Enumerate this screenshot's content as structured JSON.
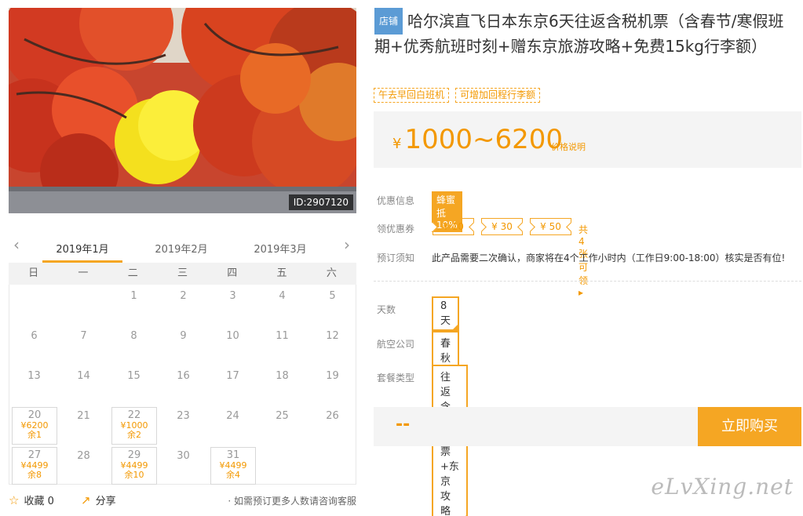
{
  "photo": {
    "id_label": "ID:2907120"
  },
  "calendar": {
    "prev_icon": "chevron-left",
    "next_icon": "chevron-right",
    "months": [
      "2019年1月",
      "2019年2月",
      "2019年3月"
    ],
    "weekdays": [
      "日",
      "一",
      "二",
      "三",
      "四",
      "五",
      "六"
    ],
    "days": [
      {
        "d": "1"
      },
      {
        "d": "2"
      },
      {
        "d": "3"
      },
      {
        "d": "4"
      },
      {
        "d": "5"
      },
      {
        "d": "6"
      },
      {
        "d": "7"
      },
      {
        "d": "8"
      },
      {
        "d": "9"
      },
      {
        "d": "10"
      },
      {
        "d": "11"
      },
      {
        "d": "12"
      },
      {
        "d": "13"
      },
      {
        "d": "14"
      },
      {
        "d": "15"
      },
      {
        "d": "16"
      },
      {
        "d": "17"
      },
      {
        "d": "18"
      },
      {
        "d": "19"
      },
      {
        "d": "20",
        "price": "¥6200",
        "remain": "余1"
      },
      {
        "d": "21"
      },
      {
        "d": "22",
        "price": "¥1000",
        "remain": "余2"
      },
      {
        "d": "23"
      },
      {
        "d": "24"
      },
      {
        "d": "25"
      },
      {
        "d": "26"
      },
      {
        "d": "27",
        "price": "¥4499",
        "remain": "余8"
      },
      {
        "d": "28"
      },
      {
        "d": "29",
        "price": "¥4499",
        "remain": "余10"
      },
      {
        "d": "30"
      },
      {
        "d": "31",
        "price": "¥4499",
        "remain": "余4"
      }
    ]
  },
  "actions": {
    "favorite_icon": "star-outline",
    "favorite_label": "收藏 0",
    "share_icon": "share",
    "share_label": "分享",
    "consult_text": "· 如需预订更多人数请咨询客服"
  },
  "product": {
    "shop_tag": "店铺",
    "title": "哈尔滨直飞日本东京6天往返含税机票（含春节/寒假班期+优秀航班时刻+赠东京旅游攻略+免费15kg行李额）",
    "tags": [
      "午去早回白班机",
      "可增加回程行李额"
    ],
    "price_symbol": "¥",
    "price_range": "1000~6200",
    "price_note": "价格说明"
  },
  "info": {
    "promo_label": "优惠信息",
    "promo_badge": "蜂蜜抵10%",
    "coupon_label": "领优惠券",
    "coupons": [
      "¥ 10",
      "¥ 30",
      "¥ 50"
    ],
    "coupon_more": "共4张可领 ▸",
    "notice_label": "预订须知",
    "notice_text": "此产品需要二次确认，商家将在4个工作小时内（工作日9:00-18:00）核实是否有位!"
  },
  "options": {
    "days_label": "天数",
    "days_value": "8天",
    "airline_label": "航空公司",
    "airline_value": "春秋航空",
    "package_label": "套餐类型",
    "package_value": "往返含税机票+东京攻略"
  },
  "buy": {
    "price_placeholder": "--",
    "button_label": "立即购买"
  },
  "watermark": "eLvXing.net",
  "colors": {
    "accent": "#f5a623",
    "price": "#f39800",
    "shop_tag": "#5b9bd5"
  }
}
